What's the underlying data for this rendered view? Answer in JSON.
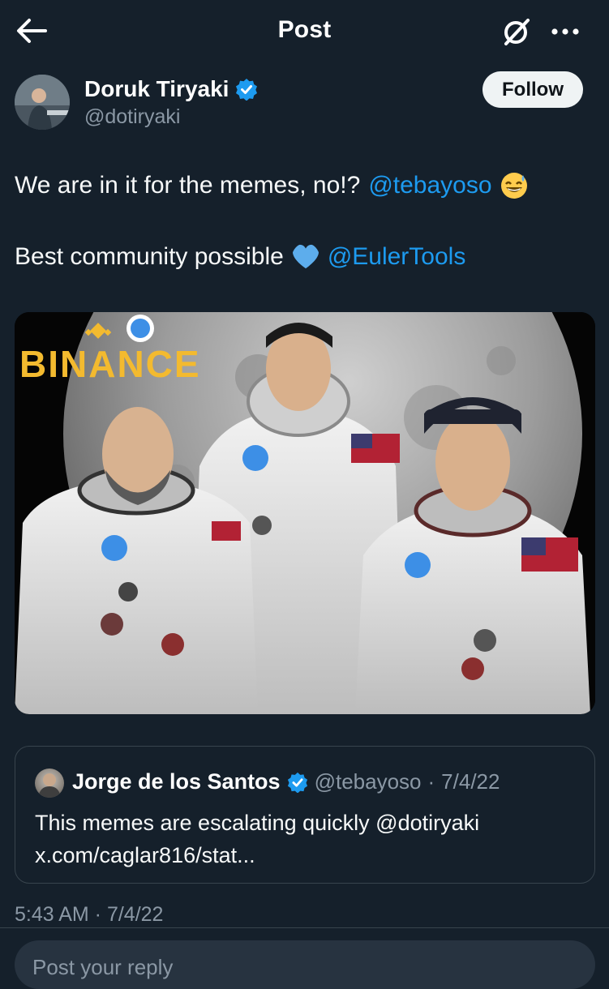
{
  "header": {
    "title": "Post",
    "back_icon": "arrow-left-icon",
    "grok_icon": "grok-slash-icon",
    "more_icon": "more-dots-icon"
  },
  "author": {
    "name": "Doruk Tiryaki",
    "handle": "@dotiryaki",
    "verified": true,
    "follow_label": "Follow"
  },
  "tweet": {
    "line1_text": "We are in it for the memes, no!?",
    "line1_mention": "@tebayoso",
    "line1_emoji": "grinning-sweat-emoji",
    "line2_text": "Best community possible",
    "line2_emoji": "blue-heart-emoji",
    "line2_mention": "@EulerTools"
  },
  "media": {
    "brand_text": "BINANCE",
    "description_icon": "meme-image"
  },
  "quote": {
    "name": "Jorge de los Santos",
    "handle": "@tebayoso",
    "date": "7/4/22",
    "text_line1": "This memes are escalating quickly @dotiryaki",
    "text_line2": "x.com/caglar816/stat..."
  },
  "timestamp": "5:43 AM · 7/4/22",
  "reply": {
    "placeholder": "Post your reply"
  },
  "colors": {
    "background": "#15202b",
    "accent": "#1d9bf0",
    "muted": "#8b98a5",
    "binance_gold": "#f3ba2f"
  }
}
